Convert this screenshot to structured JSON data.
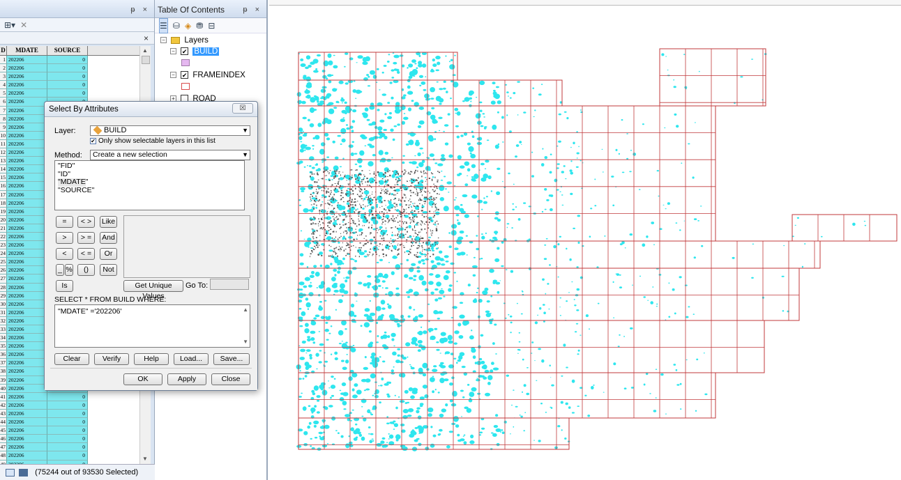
{
  "table_panel": {
    "header_pin_close": "ᵽ ×",
    "toolbar_icons": [
      "table-options-icon",
      "close-small-icon"
    ],
    "sub_close": "×",
    "columns": [
      "D",
      "MDATE",
      "SOURCE"
    ],
    "row_ids": [
      "1",
      "2",
      "3",
      "4",
      "5",
      "6",
      "7",
      "8",
      "9",
      "10",
      "11",
      "12",
      "13",
      "14",
      "15",
      "16",
      "17",
      "18",
      "19",
      "20",
      "21",
      "22",
      "23",
      "24",
      "25",
      "26",
      "27",
      "28",
      "29",
      "30",
      "31",
      "32",
      "33",
      "34",
      "35",
      "36",
      "37",
      "38",
      "39",
      "40",
      "41",
      "42",
      "43",
      "44",
      "45",
      "46",
      "47",
      "48",
      "49"
    ],
    "mdate_value": "202206",
    "source_value": "0",
    "status": "(75244 out of 93530 Selected)"
  },
  "toc": {
    "title": "Table Of Contents",
    "pin_close": "ᵽ ×",
    "layers_label": "Layers",
    "layer_build": "BUILD",
    "layer_frameindex": "FRAMEINDEX",
    "layer_road": "ROAD",
    "colors": {
      "build_swatch": "#e5b8f0",
      "frame_swatch": "#d94b4b",
      "selection": "#3399ff"
    }
  },
  "dialog": {
    "title": "Select By Attributes",
    "close_glyph": "☒",
    "layer_label": "Layer:",
    "layer_value": "BUILD",
    "only_selectable_label": "Only show selectable layers in this list",
    "method_label": "Method:",
    "method_value": "Create a new selection",
    "fields": [
      "\"FID\"",
      "\"ID\"",
      "\"MDATE\"",
      "\"SOURCE\""
    ],
    "op_buttons": {
      "eq": "=",
      "ne": "< >",
      "like": "Like",
      "gt": ">",
      "ge": "> =",
      "and": "And",
      "lt": "<",
      "le": "< =",
      "or": "Or",
      "us": "_",
      "pct": "%",
      "paren": "()",
      "not": "Not",
      "is": "Is"
    },
    "get_unique": "Get Unique Values",
    "goto_label": "Go To:",
    "sql_label": "SELECT * FROM BUILD WHERE:",
    "sql_text": "\"MDATE\" ='202206'",
    "btn_clear": "Clear",
    "btn_verify": "Verify",
    "btn_help": "Help",
    "btn_load": "Load...",
    "btn_save": "Save...",
    "btn_ok": "OK",
    "btn_apply": "Apply",
    "btn_close": "Close"
  },
  "map": {
    "colors": {
      "grid": "#c0393b",
      "feature": "#2ee6ee",
      "selected_dark": "#555555"
    }
  }
}
